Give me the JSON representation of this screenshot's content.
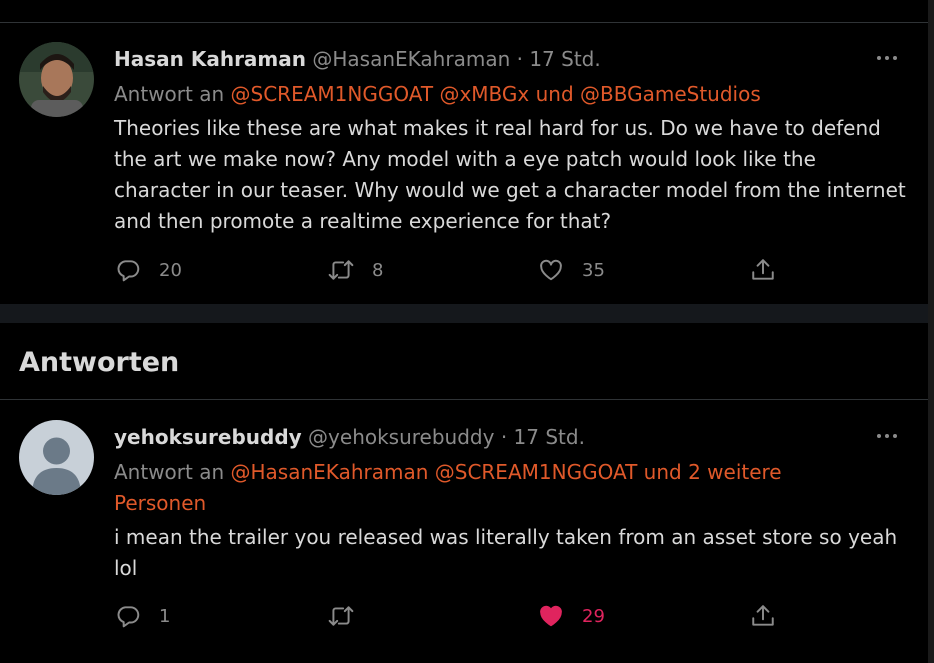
{
  "tweet_main": {
    "display_name": "Hasan Kahraman",
    "handle": "@HasanEKahraman",
    "separator": "·",
    "time": "17 Std.",
    "replying_prefix": "Antwort an",
    "mention_1": "@SCREAM1NGGOAT",
    "mention_2": "@xMBGx",
    "replying_and": "und",
    "mention_3": "@BBGameStudios",
    "text": "Theories like these are what makes it real hard for us. Do we have to defend the art we make now? Any model with a eye patch would look like the character in our teaser. Why would we get a character model from the internet and then promote a realtime experience for that?",
    "reply_count": "20",
    "retweet_count": "8",
    "like_count": "35"
  },
  "section": {
    "title": "Antworten"
  },
  "tweet_reply": {
    "display_name": "yehoksurebuddy",
    "handle": "@yehoksurebuddy",
    "separator": "·",
    "time": "17 Std.",
    "replying_prefix": "Antwort an",
    "mention_1": "@HasanEKahraman",
    "mention_2": "@SCREAM1NGGOAT",
    "others": "und 2 weitere Personen",
    "text": "i mean the trailer you released was literally taken from an asset store so yeah lol",
    "reply_count": "1",
    "like_count": "29",
    "liked": true
  },
  "colors": {
    "background": "#000000",
    "text": "#d9d9d9",
    "muted": "#8b8b8b",
    "mention": "#e0592a",
    "like": "#e0245e"
  },
  "icons": {
    "reply": "reply-icon",
    "retweet": "retweet-icon",
    "like": "heart-icon",
    "share": "share-icon",
    "more": "more-icon"
  }
}
